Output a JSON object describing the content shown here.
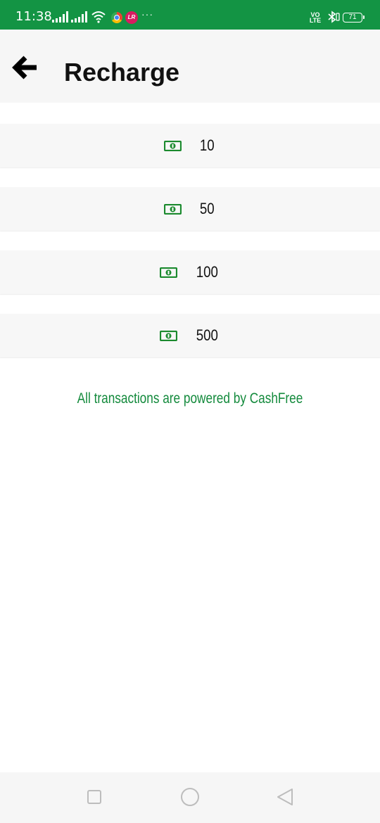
{
  "status_bar": {
    "time": "11:38",
    "dots": "···",
    "lr_badge": "LR",
    "volte": "VO LTE",
    "battery": "71"
  },
  "app_bar": {
    "title": "Recharge",
    "back_icon": "arrow-left-icon"
  },
  "amounts": [
    {
      "value": "10",
      "icon": "cash-icon"
    },
    {
      "value": "50",
      "icon": "cash-icon"
    },
    {
      "value": "100",
      "icon": "cash-icon"
    },
    {
      "value": "500",
      "icon": "cash-icon"
    }
  ],
  "footer": {
    "note": "All transactions are powered by CashFree"
  },
  "colors": {
    "status_bar": "#139444",
    "accent_text": "#138a3c",
    "cash_icon": "#1b8a2e"
  }
}
